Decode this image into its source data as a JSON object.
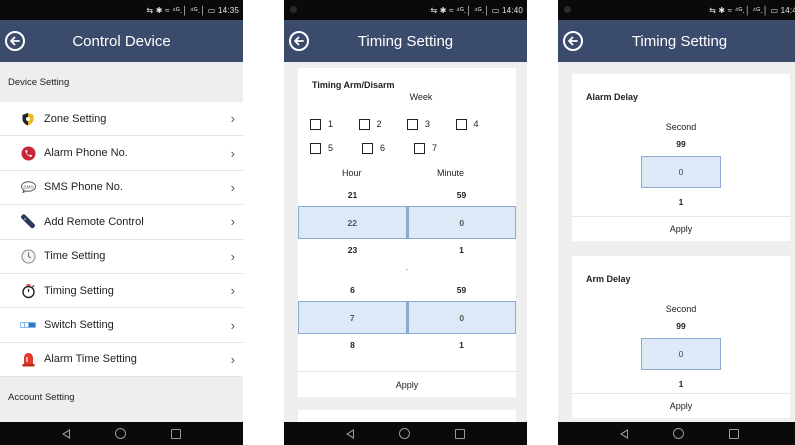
{
  "screen1": {
    "status_text": "⇆ ✱ ≈ ⁴ᴳ.│ ⁴ᴳ.│ ▭ 14:35",
    "title": "Control Device",
    "device_setting_header": "Device Setting",
    "items": [
      {
        "label": "Zone Setting",
        "icon": "zone-shield-icon"
      },
      {
        "label": "Alarm Phone No.",
        "icon": "phone-icon"
      },
      {
        "label": "SMS Phone No.",
        "icon": "sms-icon"
      },
      {
        "label": "Add Remote Control",
        "icon": "remote-control-icon"
      },
      {
        "label": "Time Setting",
        "icon": "clock-icon"
      },
      {
        "label": "Timing Setting",
        "icon": "stopwatch-icon"
      },
      {
        "label": "Switch Setting",
        "icon": "switch-icon"
      },
      {
        "label": "Alarm Time Setting",
        "icon": "alarm-siren-icon"
      }
    ],
    "account_setting_header": "Account Setting"
  },
  "screen2": {
    "status_text": "⇆ ✱ ≈ ⁴ᴳ.│ ⁴ᴳ.│ ▭ 14:40",
    "title": "Timing Setting",
    "card_title": "Timing Arm/Disarm",
    "week_label": "Week",
    "days": [
      "1",
      "2",
      "3",
      "4",
      "5",
      "6",
      "7"
    ],
    "hour_label": "Hour",
    "minute_label": "Minute",
    "arm_time": {
      "hour_prev": "21",
      "hour_sel": "22",
      "hour_next": "23",
      "minute_prev": "59",
      "minute_sel": "0",
      "minute_next": "1"
    },
    "separator": "-",
    "disarm_time": {
      "hour_prev": "6",
      "hour_sel": "7",
      "hour_next": "8",
      "minute_prev": "59",
      "minute_sel": "0",
      "minute_next": "1"
    },
    "apply_label": "Apply"
  },
  "screen3": {
    "status_text": "⇆ ✱ ≈ ⁴ᴳ.│ ⁴ᴳ.│ ▭ 14:4",
    "title": "Timing Setting",
    "alarm_delay": {
      "title": "Alarm Delay",
      "unit": "Second",
      "prev": "99",
      "value": "0",
      "next": "1",
      "apply": "Apply"
    },
    "arm_delay": {
      "title": "Arm Delay",
      "unit": "Second",
      "prev": "99",
      "value": "0",
      "next": "1",
      "apply": "Apply"
    }
  },
  "colors": {
    "appbar": "#3b4b6c",
    "selected_cell": "#dde9f7",
    "selected_border": "#8caacd"
  }
}
